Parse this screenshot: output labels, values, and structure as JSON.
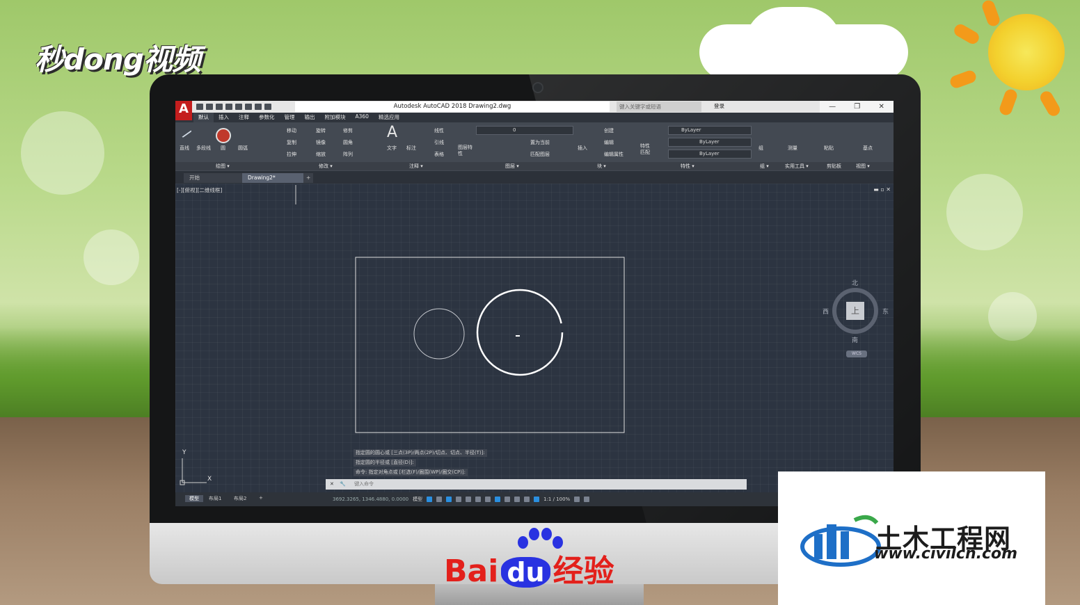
{
  "watermark": {
    "brand_text": "秒dong视频"
  },
  "app": {
    "window_title": "Autodesk AutoCAD 2018    Drawing2.dwg",
    "search_placeholder": "键入关键字或短语",
    "login": "登录",
    "logo_letter": "A"
  },
  "menu_tabs": [
    "默认",
    "插入",
    "注释",
    "参数化",
    "管理",
    "输出",
    "附加模块",
    "A360",
    "精选应用"
  ],
  "ribbon": {
    "draw": {
      "line": "直线",
      "polyline": "多段线",
      "circle": "圆",
      "arc": "圆弧"
    },
    "modify": {
      "move": "移动",
      "rotate": "旋转",
      "trim": "修剪",
      "copy": "复制",
      "mirror": "镜像",
      "fillet": "圆角",
      "stretch": "拉伸",
      "scale": "缩放",
      "array": "阵列"
    },
    "annotation": {
      "text": "文字",
      "dimension": "标注",
      "linear": "线性",
      "leader": "引线",
      "table": "表格"
    },
    "layers": {
      "props": "图层特性",
      "layer_value": "0",
      "set_current": "置为当前",
      "match": "匹配图层"
    },
    "block": {
      "insert": "插入",
      "create": "创建",
      "edit": "编辑",
      "edit_attr": "编辑属性"
    },
    "properties": {
      "match": "特性匹配",
      "color": "ByLayer",
      "linetype": "ByLayer",
      "lineweight": "ByLayer"
    },
    "panels": [
      "绘图 ▾",
      "修改 ▾",
      "注释 ▾",
      "图层 ▾",
      "块 ▾",
      "特性 ▾",
      "组 ▾",
      "实用工具 ▾",
      "剪贴板",
      "视图 ▾"
    ],
    "group": "组",
    "measure": "测量",
    "paste": "粘贴",
    "base": "基点"
  },
  "doc_tabs": {
    "start": "开始",
    "drawing": "Drawing2*"
  },
  "viewport": {
    "label": "[-][俯视][二维线框]",
    "controls": "▬ ▫ ✕"
  },
  "viewcube": {
    "north": "北",
    "south": "南",
    "east": "东",
    "west": "西",
    "top": "上",
    "wcs": "WCS"
  },
  "ucs": {
    "x": "X",
    "y": "Y"
  },
  "command_history": [
    "指定圆的圆心或 [三点(3P)/两点(2P)/切点、切点、半径(T)]:",
    "指定圆的半径或 [直径(D)]:",
    "命令: 指定对角点或 [栏选(F)/圈围(WP)/圈交(CP)]:"
  ],
  "command_input": {
    "placeholder": "键入命令"
  },
  "layout_tabs": [
    "模型",
    "布局1",
    "布局2"
  ],
  "status": {
    "coords": "3692.3265, 1346.4880, 0.0000",
    "model": "模型",
    "scale": "1:1 / 100%"
  },
  "logos": {
    "baidu_left": "Bai",
    "baidu_du": "du",
    "baidu_right": "经验",
    "civil_name": "土木工程网",
    "civil_url": "www.civilcn.com"
  }
}
